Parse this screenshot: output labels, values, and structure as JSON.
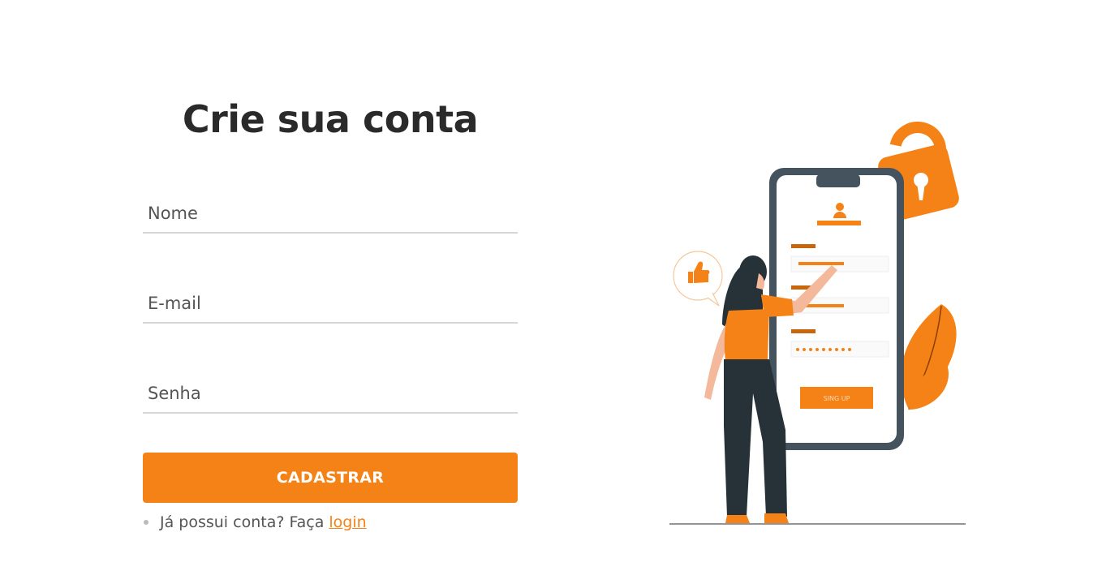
{
  "form": {
    "title": "Crie sua conta",
    "name_placeholder": "Nome",
    "email_placeholder": "E-mail",
    "password_placeholder": "Senha",
    "submit_label": "CADASTRAR",
    "login_prompt": "Já possui conta? Faça",
    "login_link": "login"
  },
  "illustration": {
    "phone_button_label": "SING UP"
  },
  "colors": {
    "accent": "#f58216",
    "phone_frame": "#45535e",
    "title": "#2a2a2a"
  }
}
